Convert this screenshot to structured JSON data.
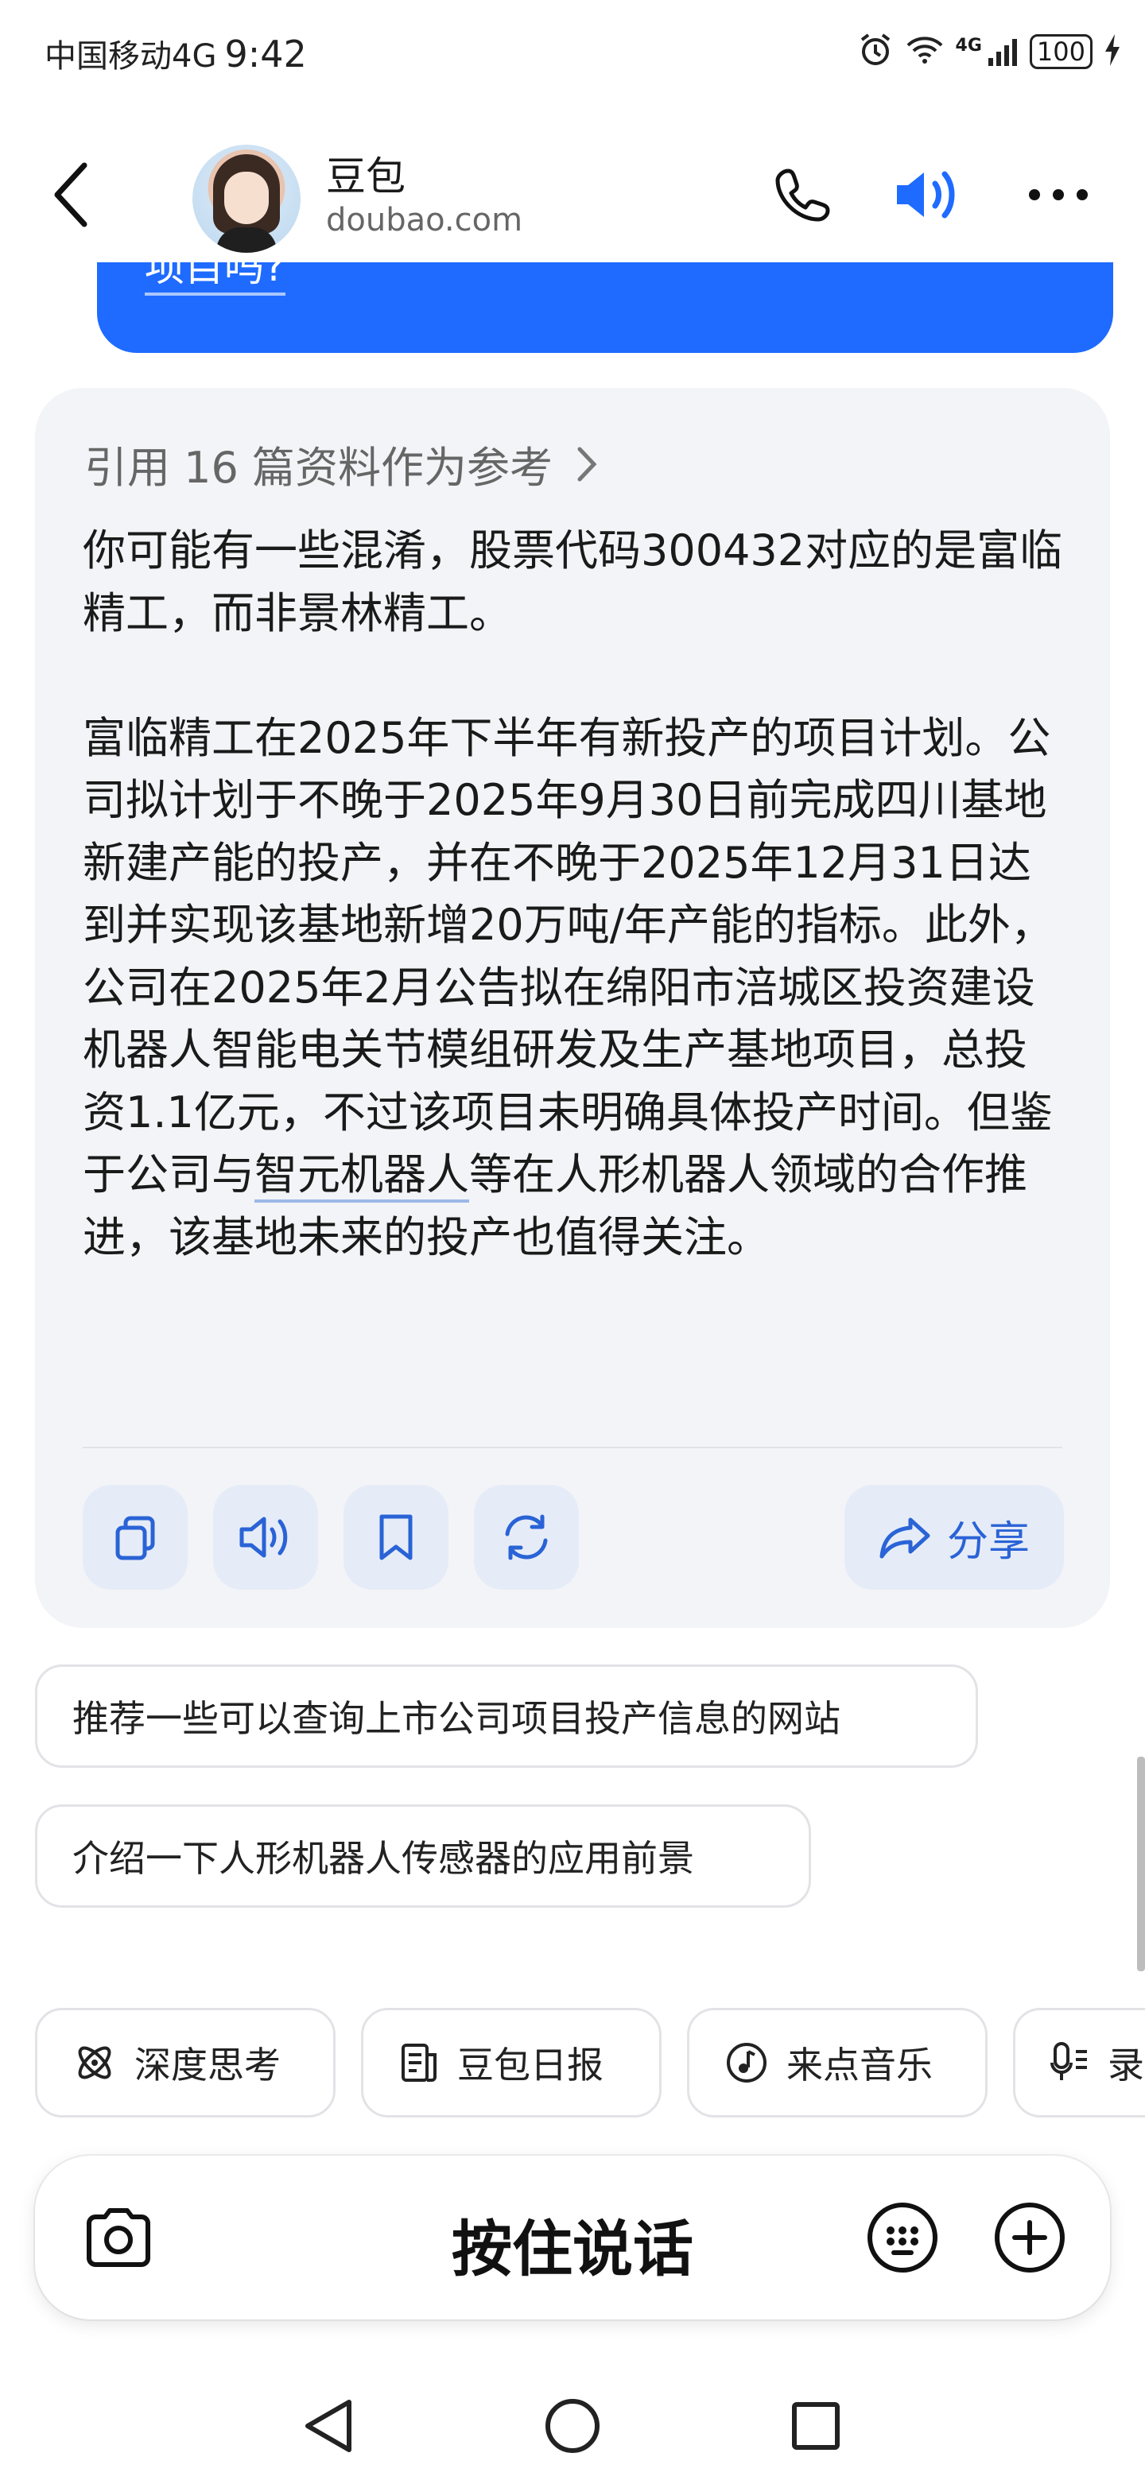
{
  "status_bar": {
    "carrier": "中国移动4G",
    "time": "9:42",
    "network": "4G",
    "battery": "100"
  },
  "header": {
    "title": "豆包",
    "subtitle": "doubao.com"
  },
  "prev_message": {
    "text": "项目吗?"
  },
  "answer": {
    "reference": "引用 16 篇资料作为参考",
    "paragraph1": "你可能有一些混淆，股票代码300432对应的是富临精工，而非景林精工。",
    "paragraph2_before_link": "富临精工在2025年下半年有新投产的项目计划。公司拟计划于不晚于2025年9月30日前完成四川基地新建产能的投产，并在不晚于2025年12月31日达到并实现该基地新增20万吨/年产能的指标。此外，公司在2025年2月公告拟在绵阳市涪城区投资建设机器人智能电关节模组研发及生产基地项目，总投资1.1亿元，不过该项目未明确具体投产时间。但鉴于公司与",
    "link_text": "智元机器人",
    "paragraph2_after_link": "等在人形机器人领域的合作推进，该基地未来的投产也值得关注。",
    "share_label": "分享"
  },
  "suggestions": [
    "推荐一些可以查询上市公司项目投产信息的网站",
    "介绍一下人形机器人传感器的应用前景"
  ],
  "quick_chips": [
    {
      "label": "深度思考",
      "icon": "atom-icon"
    },
    {
      "label": "豆包日报",
      "icon": "news-icon"
    },
    {
      "label": "来点音乐",
      "icon": "music-icon"
    },
    {
      "label": "录",
      "icon": "mic-icon"
    }
  ],
  "input": {
    "hold_to_talk": "按住说话"
  },
  "colors": {
    "accent": "#1f6bff",
    "action_blue": "#2a63d6",
    "card_bg": "#f3f4f7"
  }
}
